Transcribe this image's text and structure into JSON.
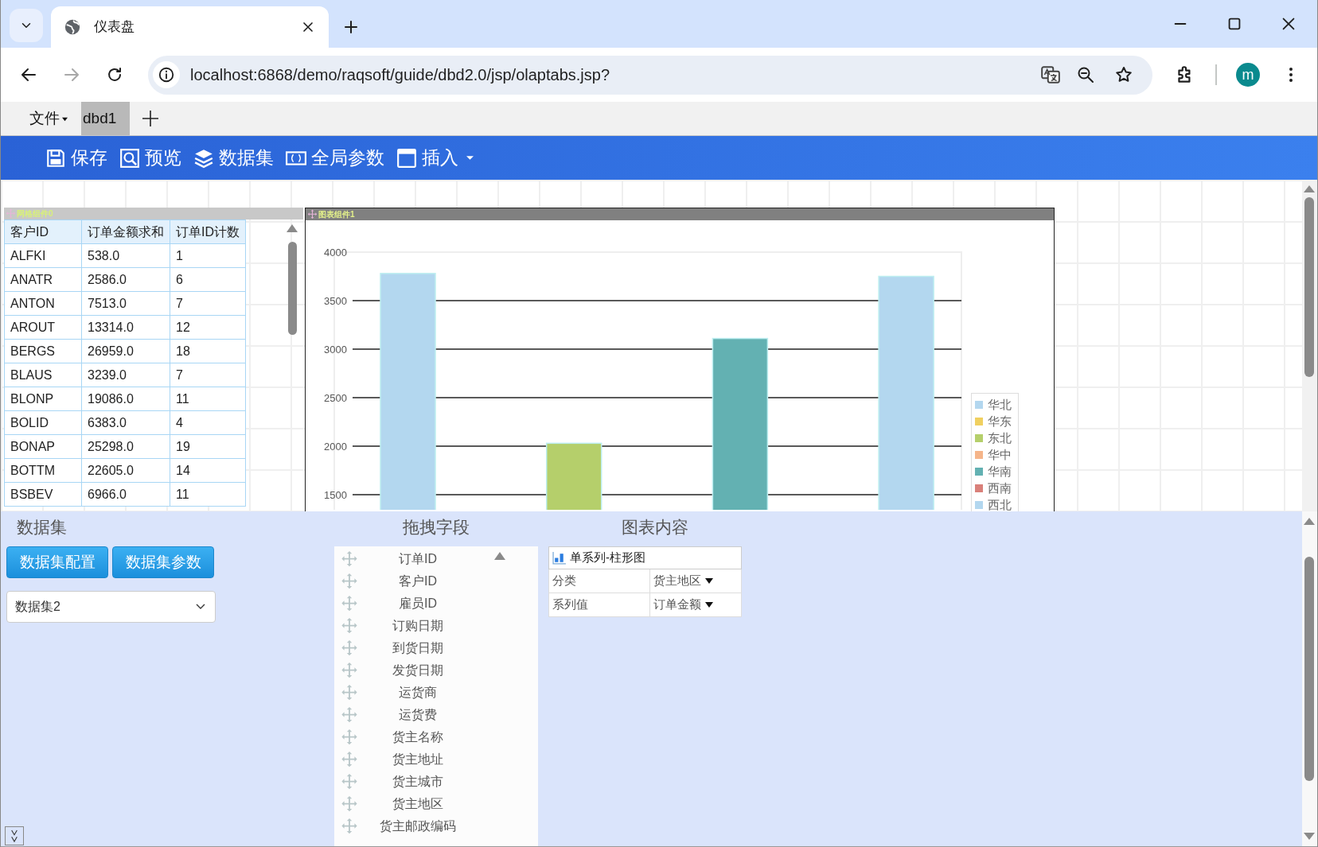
{
  "browser": {
    "tab_title": "仪表盘",
    "url": "localhost:6868/demo/raqsoft/guide/dbd2.0/jsp/olaptabs.jsp?",
    "avatar": "m"
  },
  "app": {
    "menu": [
      {
        "label": "文件"
      }
    ],
    "doc_tabs": [
      {
        "label": "dbd1",
        "selected": true
      }
    ]
  },
  "toolbar": [
    {
      "kind": "save",
      "label": "保存",
      "dropdown": false
    },
    {
      "kind": "preview",
      "label": "预览",
      "dropdown": false
    },
    {
      "kind": "dataset",
      "label": "数据集",
      "dropdown": false
    },
    {
      "kind": "params",
      "label": "全局参数",
      "dropdown": false
    },
    {
      "kind": "insert",
      "label": "插入",
      "dropdown": true
    }
  ],
  "grid_component": {
    "title": "网格组件0",
    "columns": [
      "客户ID",
      "订单金额求和",
      "订单ID计数"
    ],
    "rows": [
      [
        "ALFKI",
        "538.0",
        "1"
      ],
      [
        "ANATR",
        "2586.0",
        "6"
      ],
      [
        "ANTON",
        "7513.0",
        "7"
      ],
      [
        "AROUT",
        "13314.0",
        "12"
      ],
      [
        "BERGS",
        "26959.0",
        "18"
      ],
      [
        "BLAUS",
        "3239.0",
        "7"
      ],
      [
        "BLONP",
        "19086.0",
        "11"
      ],
      [
        "BOLID",
        "6383.0",
        "4"
      ],
      [
        "BONAP",
        "25298.0",
        "19"
      ],
      [
        "BOTTM",
        "22605.0",
        "14"
      ],
      [
        "BSBEV",
        "6966.0",
        "11"
      ]
    ]
  },
  "chart_component": {
    "title": "图表组件1",
    "chart_data": {
      "type": "bar",
      "grid": true,
      "ylim": [
        1500,
        4000
      ],
      "yticks": [
        1500,
        2000,
        2500,
        3000,
        3500,
        4000
      ],
      "series": [
        {
          "values": [
            3780,
            2030,
            3110,
            3750
          ],
          "colors": [
            "#b3d7ef",
            "#b5cf6b",
            "#63b1b2",
            "#b3d7ef"
          ]
        }
      ]
    },
    "legend": [
      {
        "label": "华北",
        "color": "#b3d7ef"
      },
      {
        "label": "华东",
        "color": "#f0d060"
      },
      {
        "label": "东北",
        "color": "#b5cf6b"
      },
      {
        "label": "华中",
        "color": "#f5b58a"
      },
      {
        "label": "华南",
        "color": "#63b1b2"
      },
      {
        "label": "西南",
        "color": "#d9807a"
      },
      {
        "label": "西北",
        "color": "#b3d7ef"
      }
    ]
  },
  "dataset_panel": {
    "heading": "数据集",
    "buttons": [
      "数据集配置",
      "数据集参数"
    ],
    "select_value": "数据集2"
  },
  "fields_panel": {
    "heading": "拖拽字段",
    "fields": [
      "订单ID",
      "客户ID",
      "雇员ID",
      "订购日期",
      "到货日期",
      "发货日期",
      "运货商",
      "运货费",
      "货主名称",
      "货主地址",
      "货主城市",
      "货主地区",
      "货主邮政编码"
    ]
  },
  "chart_content": {
    "heading": "图表内容",
    "chart_type": "单系列-柱形图",
    "properties": [
      {
        "label": "分类",
        "value": "货主地区"
      },
      {
        "label": "系列值",
        "value": "订单金额"
      }
    ]
  }
}
